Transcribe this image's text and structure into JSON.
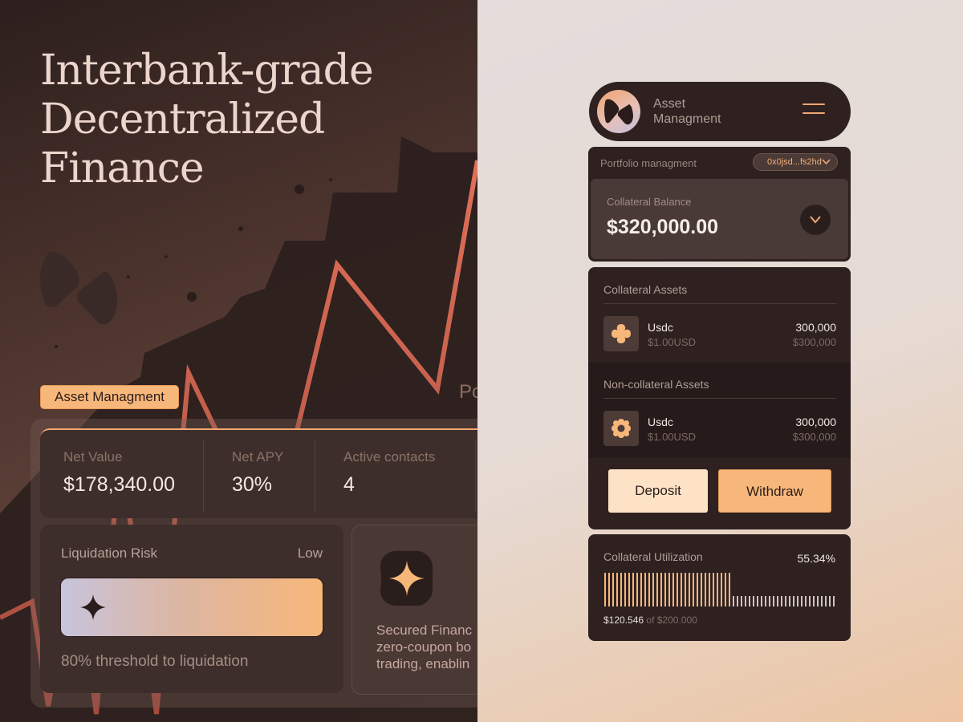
{
  "hero": {
    "headline": [
      "Interbank-grade",
      "Decentralized",
      "Finance"
    ],
    "tag": "Asset Managment",
    "cut_text": "Po"
  },
  "stats": [
    {
      "label": "Net Value",
      "value": "$178,340.00"
    },
    {
      "label": "Net APY",
      "value": "30%"
    },
    {
      "label": "Active contacts",
      "value": "4"
    }
  ],
  "liquidation": {
    "title": "Liquidation Risk",
    "level": "Low",
    "footer": "80% threshold to liquidation"
  },
  "secured": {
    "lines": [
      "Secured Financ",
      "zero-coupon bo",
      "trading, enablin"
    ]
  },
  "app": {
    "name_line1": "Asset",
    "name_line2": "Managment",
    "portfolio_label": "Portfolio managment",
    "wallet_address": "0x0jsd...fs2hd",
    "collateral_balance_label": "Collateral Balance",
    "collateral_balance": "$320,000.00"
  },
  "collateral_assets": {
    "title": "Collateral Assets",
    "items": [
      {
        "name": "Usdc",
        "price": "$1.00USD",
        "qty": "300,000",
        "usd": "$300,000"
      }
    ]
  },
  "non_collateral_assets": {
    "title": "Non-collateral Assets",
    "items": [
      {
        "name": "Usdc",
        "price": "$1.00USD",
        "qty": "300,000",
        "usd": "$300,000"
      }
    ]
  },
  "actions": {
    "deposit": "Deposit",
    "withdraw": "Withdraw"
  },
  "utilization": {
    "title": "Collateral Utilization",
    "percent": "55.34%",
    "fraction": 0.5534,
    "current": "$120.546",
    "of_text": "of $200.000"
  },
  "colors": {
    "accent": "#f8b77a",
    "dark_card": "#2e2120",
    "chart_line": "#d2644e"
  }
}
